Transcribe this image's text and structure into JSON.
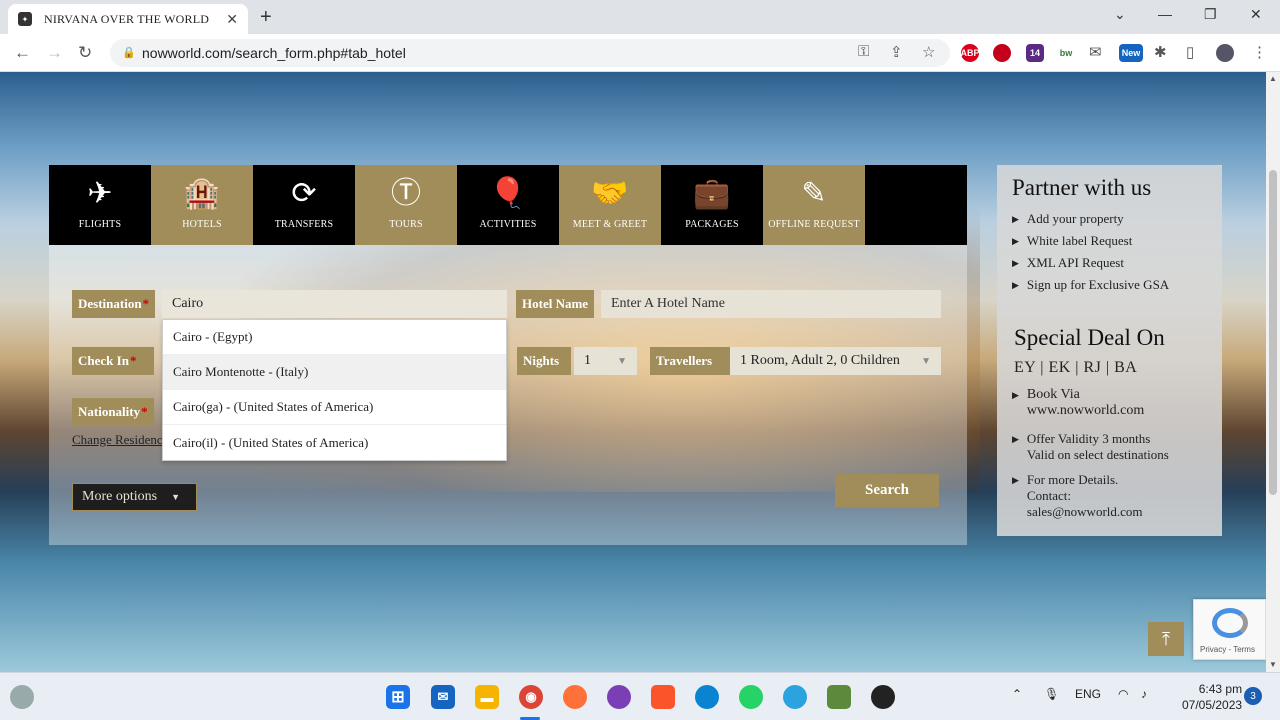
{
  "browser": {
    "tab_title": "NIRVANA OVER THE WORLD",
    "url": "nowworld.com/search_form.php#tab_hotel",
    "extensions": [
      "ABP",
      "14",
      "bw",
      "New"
    ]
  },
  "search_tabs": [
    {
      "label": "FLIGHTS",
      "icon": "✈"
    },
    {
      "label": "HOTELS",
      "icon": "🏨"
    },
    {
      "label": "TRANSFERS",
      "icon": "⟳"
    },
    {
      "label": "TOURS",
      "icon": "Ⓣ"
    },
    {
      "label": "ACTIVITIES",
      "icon": "🎈"
    },
    {
      "label": "MEET & GREET",
      "icon": "🤝"
    },
    {
      "label": "PACKAGES",
      "icon": "💼"
    },
    {
      "label": "OFFLINE REQUEST",
      "icon": "✎"
    }
  ],
  "form": {
    "destination_label": "Destination",
    "destination_value": "Cairo",
    "hotel_name_label": "Hotel Name",
    "hotel_name_placeholder": "Enter A Hotel Name",
    "checkin_label": "Check In",
    "nights_label": "Nights",
    "nights_value": "1",
    "travellers_label": "Travellers",
    "travellers_value": "1 Room, Adult 2, 0 Children",
    "nationality_label": "Nationality",
    "required_mark": "*",
    "change_residence": "Change Residence",
    "more_options": "More options",
    "search_button": "Search"
  },
  "suggestions": [
    "Cairo - (Egypt)",
    "Cairo Montenotte - (Italy)",
    "Cairo(ga) - (United States of America)",
    "Cairo(il) - (United States of America)"
  ],
  "sidebar": {
    "partner_title": "Partner with us",
    "partner_items": [
      "Add your property",
      "White label Request",
      "XML API Request",
      "Sign up for Exclusive GSA"
    ],
    "deal_title": "Special Deal On",
    "deal_airlines": "EY | EK | RJ | BA",
    "deal_items": [
      {
        "line1": "Book Via",
        "line2": "www.nowworld.com"
      },
      {
        "line1": "Offer Validity 3 months",
        "line2": "Valid on select destinations"
      },
      {
        "line1": "For more Details.",
        "line2": "Contact:",
        "line3": "sales@nowworld.com"
      }
    ]
  },
  "recaptcha": {
    "text": "Privacy - Terms"
  },
  "taskbar": {
    "language": "ENG",
    "time": "6:43 pm",
    "date": "07/05/2023",
    "notifications": "3"
  },
  "colors": {
    "accent_gold": "#a18d5a",
    "tab_black": "#000000"
  }
}
